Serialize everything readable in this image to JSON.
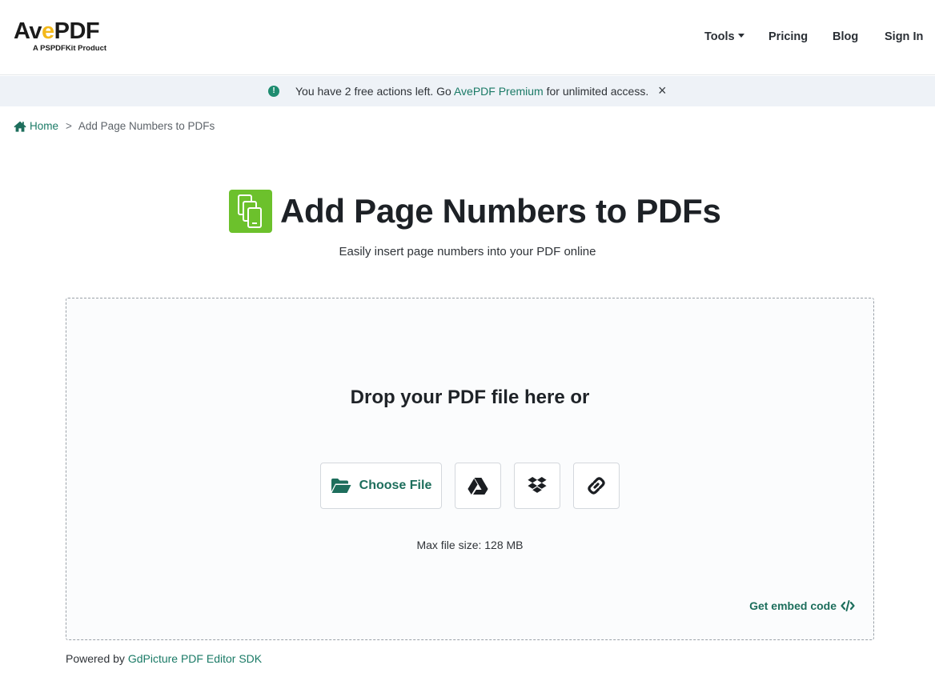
{
  "header": {
    "logo_main_a": "Av",
    "logo_main_e": "e",
    "logo_main_b": "PDF",
    "logo_sub": "A PSPDFKit Product",
    "nav": {
      "tools": "Tools",
      "pricing": "Pricing",
      "blog": "Blog",
      "sign_in": "Sign In"
    }
  },
  "banner": {
    "icon": "!",
    "text_before": "You have 2 free actions left. Go ",
    "link": "AvePDF Premium",
    "text_after": " for unlimited access.",
    "close": "×"
  },
  "breadcrumb": {
    "home": "Home",
    "separator": ">",
    "current": "Add Page Numbers to PDFs"
  },
  "main": {
    "title": "Add Page Numbers to PDFs",
    "subtitle": "Easily insert page numbers into your PDF online",
    "drop_title": "Drop your PDF file here or",
    "choose_file": "Choose File",
    "max_size": "Max file size: 128 MB",
    "embed": "Get embed code"
  },
  "footer": {
    "powered_prefix": "Powered by ",
    "powered_link": "GdPicture PDF Editor SDK"
  },
  "colors": {
    "accent": "#1d6e5c",
    "tool_icon": "#6cc12c",
    "logo_e": "#f3b81a",
    "banner_bg": "#eef2f7"
  },
  "icons": [
    "home-icon",
    "info-icon",
    "close-icon",
    "page-numbers-icon",
    "folder-open-icon",
    "google-drive-icon",
    "dropbox-icon",
    "link-icon",
    "code-icon"
  ]
}
